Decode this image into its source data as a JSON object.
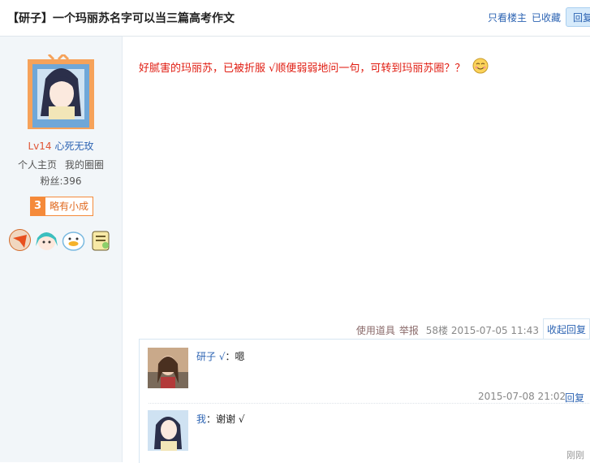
{
  "header": {
    "title": "【研子】一个玛丽苏名字可以当三篇高考作文",
    "only_op": "只看楼主",
    "favorited": "已收藏",
    "reply_btn": "回复"
  },
  "author": {
    "level": "Lv14",
    "name": "心死无玫",
    "home_link": "个人主页",
    "circle_link": "我的圈圈",
    "fans": "粉丝:396",
    "badge_num": "3",
    "badge_text": "略有小成"
  },
  "post": {
    "content": "好腻害的玛丽苏，已被折服 √顺便弱弱地问一句，可转到玛丽苏圈？？",
    "use_tool": "使用道具",
    "report": "举报",
    "floor": "58楼",
    "time": "2015-07-05 11:43",
    "collapse_label": "收起回复"
  },
  "replies": [
    {
      "name": "研子 √",
      "sep": "：",
      "text": "嗯",
      "time": "2015-07-08 21:02",
      "reply_label": "回复"
    },
    {
      "name": "我",
      "sep": "：",
      "text": "谢谢 √",
      "time": "刚刚"
    }
  ],
  "colors": {
    "accent": "#2d64b3",
    "red": "#e01b10",
    "orange": "#f58a3a"
  }
}
